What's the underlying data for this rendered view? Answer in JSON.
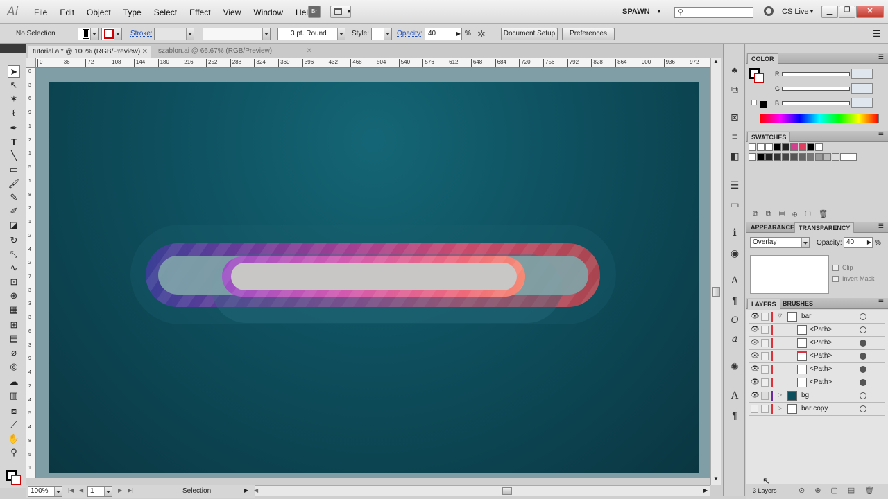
{
  "app": {
    "logo": "Ai",
    "bridge": "Br"
  },
  "menu": [
    "File",
    "Edit",
    "Object",
    "Type",
    "Select",
    "Effect",
    "View",
    "Window",
    "Help"
  ],
  "workspace": "SPAWN",
  "cslive": "CS Live",
  "control": {
    "selection": "No Selection",
    "stroke_label": "Stroke:",
    "brush": "3 pt. Round",
    "style_label": "Style:",
    "opacity_label": "Opacity:",
    "opacity_value": "40",
    "percent": "%",
    "document_setup": "Document Setup",
    "preferences": "Preferences"
  },
  "tabs": [
    {
      "label": "tutorial.ai* @ 100% (RGB/Preview)"
    },
    {
      "label": "szablon.ai @ 66.67% (RGB/Preview)"
    }
  ],
  "ruler_ticks": [
    "0",
    "36",
    "72",
    "108",
    "144",
    "180",
    "216",
    "252",
    "288",
    "324",
    "360",
    "396",
    "432",
    "468",
    "504",
    "540",
    "576",
    "612",
    "648",
    "684",
    "720",
    "756",
    "792",
    "828",
    "864",
    "900",
    "936",
    "972"
  ],
  "vruler_ticks": [
    "0",
    "3",
    "6",
    "9",
    "1",
    "2",
    "1",
    "5",
    "1",
    "8",
    "2",
    "1",
    "2",
    "4",
    "2",
    "7",
    "3",
    "3",
    "3",
    "6",
    "3",
    "9",
    "4",
    "2",
    "4",
    "5",
    "4",
    "8",
    "5",
    "1"
  ],
  "panels": {
    "color": {
      "title": "COLOR",
      "channels": [
        "R",
        "G",
        "B"
      ]
    },
    "swatches": {
      "title": "SWATCHES"
    },
    "appearance": {
      "title": "APPEARANCE"
    },
    "transparency": {
      "title": "TRANSPARENCY",
      "blend_mode": "Overlay",
      "opacity_label": "Opacity:",
      "opacity_value": "40",
      "percent": "%",
      "clip": "Clip",
      "invert_mask": "Invert Mask"
    },
    "layers": {
      "title": "LAYERS",
      "brushes_title": "BRUSHES",
      "count": "3 Layers"
    }
  },
  "layers": [
    {
      "name": "bar",
      "type": "layer",
      "thumb_color": "#ffffff",
      "target_filled": false
    },
    {
      "name": "<Path>",
      "type": "sub",
      "thumb_color": "#ffffff",
      "target_filled": false
    },
    {
      "name": "<Path>",
      "type": "sub",
      "thumb_color": "#ffffff",
      "target_filled": true
    },
    {
      "name": "<Path>",
      "type": "sub",
      "thumb_color": "#e03040",
      "target_filled": true
    },
    {
      "name": "<Path>",
      "type": "sub",
      "thumb_color": "#ffffff",
      "target_filled": true
    },
    {
      "name": "<Path>",
      "type": "sub",
      "thumb_color": "#ffffff",
      "target_filled": true
    },
    {
      "name": "bg",
      "type": "layer",
      "thumb_color": "#0e4f5e",
      "target_filled": false
    },
    {
      "name": "bar copy",
      "type": "layer",
      "thumb_color": "#ffffff",
      "target_filled": false
    }
  ],
  "status": {
    "zoom": "100%",
    "page": "1",
    "tool": "Selection"
  },
  "colors": {
    "artboard": "#0e4f5e",
    "pasteboard": "#7f9ea6",
    "accent_red": "#e0303a",
    "pill_light": "#c9c6c6"
  },
  "icons": [
    "selection-icon",
    "direct-selection-icon",
    "magic-wand-icon",
    "lasso-icon",
    "pen-icon",
    "type-icon",
    "line-icon",
    "rectangle-icon",
    "paintbrush-icon",
    "pencil-icon",
    "eraser-icon",
    "rotate-icon",
    "scale-icon",
    "warp-icon",
    "free-transform-icon",
    "symbol-sprayer-icon",
    "graph-icon",
    "mesh-icon",
    "gradient-icon",
    "eyedropper-icon",
    "blend-icon",
    "slice-icon",
    "hand-icon",
    "zoom-icon"
  ]
}
